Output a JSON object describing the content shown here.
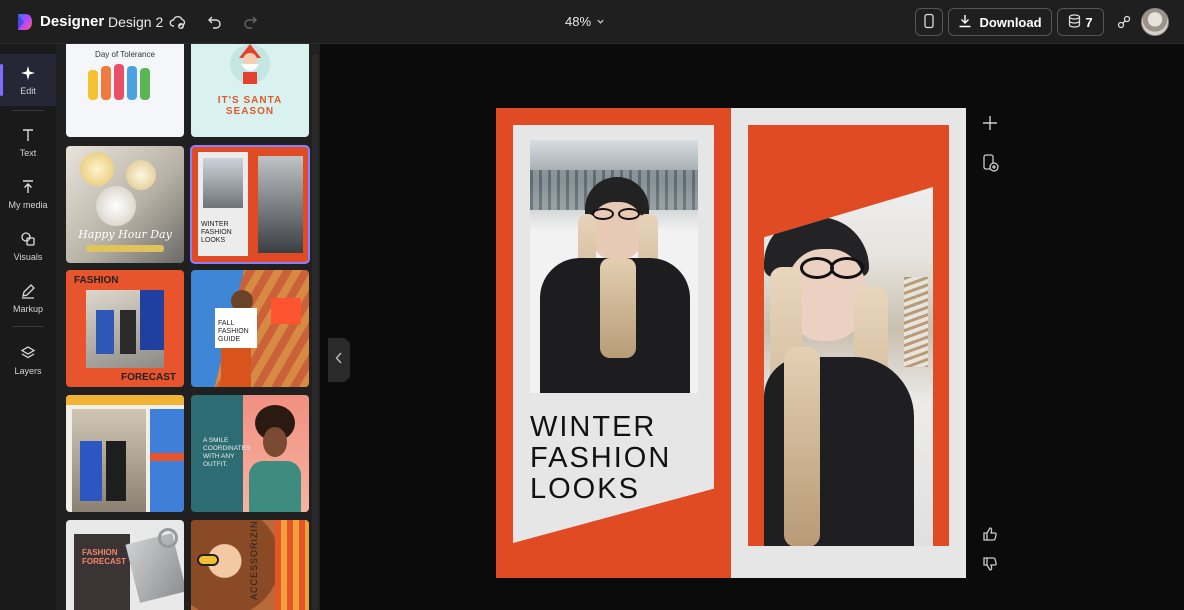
{
  "app": {
    "brand": "Designer",
    "doc_name": "Design 2"
  },
  "toolbar": {
    "zoom": "48%",
    "download_label": "Download",
    "credits": "7"
  },
  "rail": [
    {
      "label": "Edit",
      "icon": "sparkle-icon"
    },
    {
      "label": "Text",
      "icon": "text-icon"
    },
    {
      "label": "My media",
      "icon": "upload-icon"
    },
    {
      "label": "Visuals",
      "icon": "shapes-icon"
    },
    {
      "label": "Markup",
      "icon": "pen-icon"
    },
    {
      "label": "Layers",
      "icon": "layers-icon"
    }
  ],
  "templates": [
    {
      "title": "Day of Tolerance"
    },
    {
      "title": "IT'S SANTA SEASON"
    },
    {
      "title": "Happy Hour Day"
    },
    {
      "title": "WINTER FASHION LOOKS"
    },
    {
      "title_top": "FASHION",
      "title_bottom": "FORECAST"
    },
    {
      "title": "FALL FASHION GUIDE"
    },
    {
      "title": "",
      "note": "photo template"
    },
    {
      "title": "A SMILE COORDINATES WITH ANY OUTFIT."
    },
    {
      "title": "FASHION FORECAST"
    },
    {
      "title": "ACCESSORIZING"
    }
  ],
  "design": {
    "headline_lines": [
      "WINTER",
      "FASHION",
      "LOOKS"
    ]
  },
  "colors": {
    "accent": "#e14b24",
    "selection": "#8a80ff",
    "brand_purple": "#7f6bff"
  }
}
